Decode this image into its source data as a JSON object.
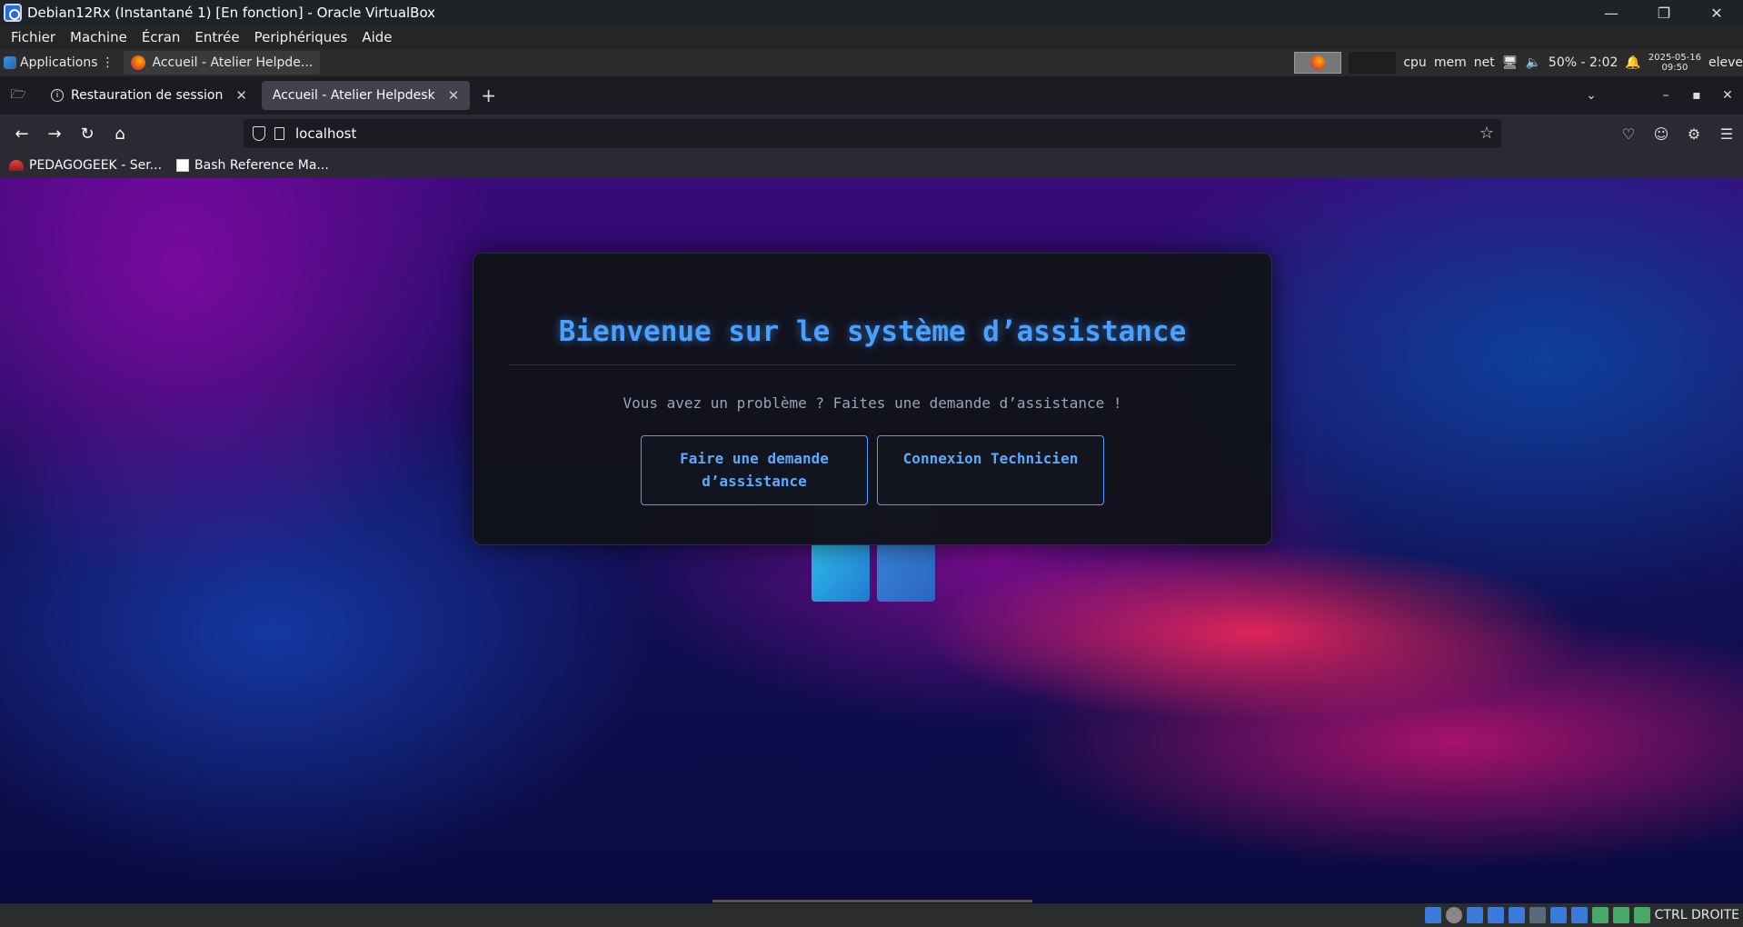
{
  "vbox": {
    "title": "Debian12Rx (Instantané 1) [En fonction] - Oracle VirtualBox",
    "menu": [
      "Fichier",
      "Machine",
      "Écran",
      "Entrée",
      "Periphériques",
      "Aide"
    ],
    "status_label": "CTRL DROITE"
  },
  "guest_panel": {
    "applications_label": "Applications",
    "task_label": "Accueil - Atelier Helpde...",
    "cpu_label": "cpu",
    "mem_label": "mem",
    "net_label": "net",
    "battery_label": "50% - 2:02",
    "date": "2025-05-16",
    "time": "09:50",
    "user": "eleve"
  },
  "browser": {
    "tabs": [
      {
        "label": "Restauration de session",
        "active": false
      },
      {
        "label": "Accueil - Atelier Helpdesk",
        "active": true
      }
    ],
    "url": "localhost",
    "bookmarks": [
      "PEDAGOGEEK - Ser...",
      "Bash Reference Ma..."
    ]
  },
  "page": {
    "heading": "Bienvenue sur le système d’assistance",
    "subtitle": "Vous avez un problème ? Faites une demande d’assistance !",
    "request_button": "Faire une demande d’assistance",
    "technician_button": "Connexion Technicien"
  },
  "colors": {
    "accent": "#4aa0ff",
    "card_bg": "#11131a"
  }
}
